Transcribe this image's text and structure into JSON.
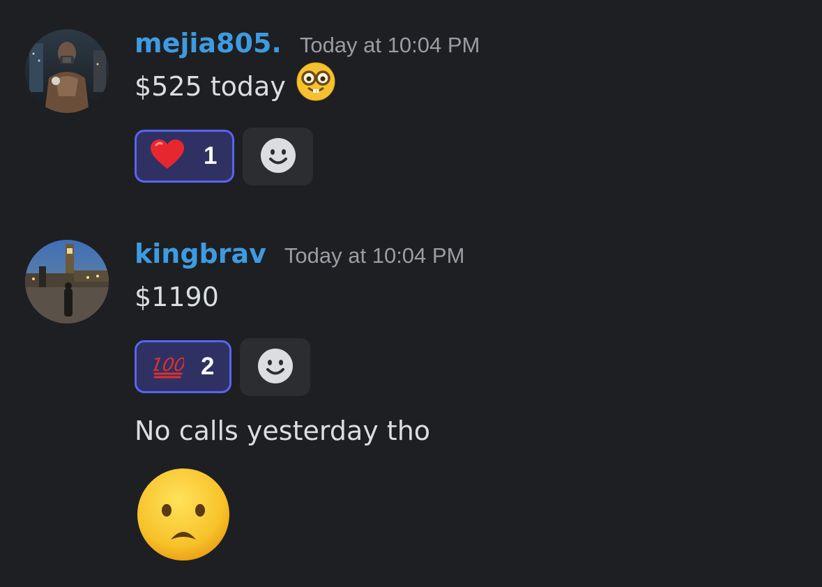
{
  "messages": [
    {
      "username": "mejia805.",
      "timestamp": "Today at 10:04 PM",
      "text": "$525 today",
      "text_emoji": "nerd-face-emoji",
      "reaction": {
        "emoji": "red-heart-emoji",
        "count": "1"
      }
    },
    {
      "username": "kingbrav",
      "timestamp": "Today at 10:04 PM",
      "text": "$1190",
      "reaction": {
        "emoji": "hundred-points-emoji",
        "count": "2"
      },
      "followup_text": "No calls yesterday tho",
      "followup_emoji": "frowning-face-emoji"
    }
  ],
  "colors": {
    "background": "#1e1f22",
    "username": "#3d9be0",
    "timestamp": "#9b9da3",
    "text": "#dbdee1",
    "reaction_border": "#5865f2",
    "reaction_bg": "#2f3163",
    "add_reaction_bg": "#2b2d31"
  }
}
